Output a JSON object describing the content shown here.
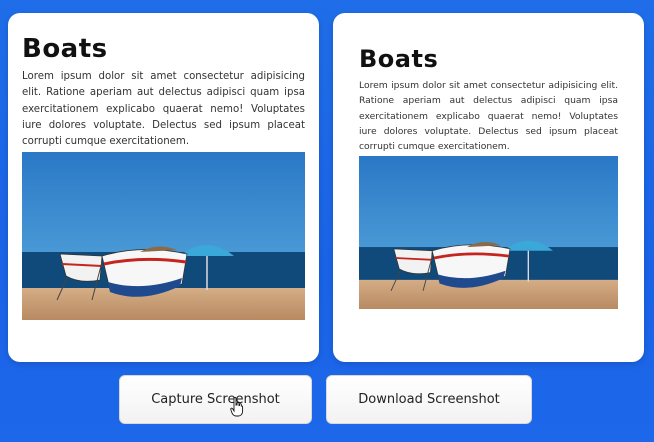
{
  "cards": [
    {
      "title": "Boats",
      "text": "Lorem ipsum dolor sit amet consectetur adipisicing elit. Ratione aperiam aut delectus adipisci quam ipsa exercitationem explicabo quaerat nemo! Voluptates iure dolores voluptate. Delectus sed ipsum placeat corrupti cumque exercitationem."
    },
    {
      "title": "Boats",
      "text": "Lorem ipsum dolor sit amet consectetur adipisicing elit. Ratione aperiam aut delectus adipisci quam ipsa exercitationem explicabo quaerat nemo! Voluptates iure dolores voluptate. Delectus sed ipsum placeat corrupti cumque exercitationem."
    }
  ],
  "buttons": {
    "capture_label": "Capture Screenshot",
    "download_label": "Download Screenshot"
  },
  "colors": {
    "background": "#1a63e6",
    "sky": "#2f7ec4",
    "sea": "#0f4a7a",
    "sand": "#c9a27a",
    "boat_red": "#c4261f"
  },
  "icons": {
    "cursor": "hand-pointer-icon"
  }
}
